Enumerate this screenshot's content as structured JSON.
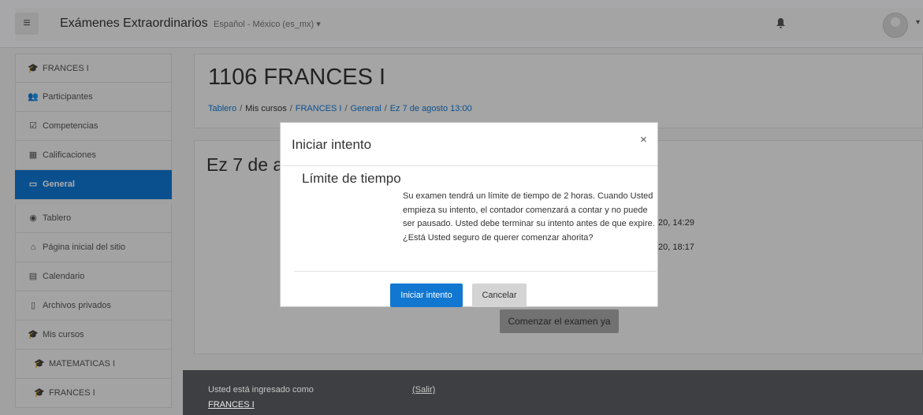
{
  "navbar": {
    "title": "Exámenes Extraordinarios",
    "language": "Español - México (es_mx) ▾",
    "hamburger_icon": "≡",
    "bell_icon": "🔔",
    "avatar_caret": "▾"
  },
  "sidebar": {
    "items": [
      {
        "icon": "graduation-cap-icon",
        "glyph": "🎓",
        "label": "FRANCES I"
      },
      {
        "icon": "users-icon",
        "glyph": "👥",
        "label": "Participantes"
      },
      {
        "icon": "check-square-icon",
        "glyph": "☑",
        "label": "Competencias"
      },
      {
        "icon": "table-icon",
        "glyph": "▦",
        "label": "Calificaciones"
      },
      {
        "icon": "folder-icon",
        "glyph": "▭",
        "label": "General",
        "active": true
      }
    ],
    "items2": [
      {
        "icon": "dashboard-icon",
        "glyph": "◉",
        "label": "Tablero"
      },
      {
        "icon": "home-icon",
        "glyph": "⌂",
        "label": "Página inicial del sitio"
      },
      {
        "icon": "calendar-icon",
        "glyph": "▤",
        "label": "Calendario"
      },
      {
        "icon": "file-icon",
        "glyph": "▯",
        "label": "Archivos privados"
      },
      {
        "icon": "graduation-cap-icon",
        "glyph": "🎓",
        "label": "Mis cursos"
      },
      {
        "icon": "graduation-cap-icon",
        "glyph": "🎓",
        "label": "MATEMATICAS I"
      },
      {
        "icon": "graduation-cap-icon",
        "glyph": "🎓",
        "label": "FRANCES I"
      }
    ]
  },
  "header": {
    "title": "1106 FRANCES I",
    "breadcrumb": [
      "Tablero",
      "Mis cursos",
      "FRANCES I",
      "General",
      "Ez 7 de agosto 13:00"
    ]
  },
  "content": {
    "section_title": "Ez 7 de a",
    "info_line_1": "20, 14:29",
    "info_line_2": "20, 18:17",
    "start_button": "Comenzar el examen ya"
  },
  "modal": {
    "title": "Iniciar intento",
    "close": "×",
    "subtitle": "Límite de tiempo",
    "text": "Su examen tendrá un límite de tiempo de 2 horas. Cuando Usted empieza su intento, el contador comenzará a contar y no puede ser pausado. Usted debe terminar su intento antes de que expire. ¿Está Usted seguro de querer comenzar ahorita?",
    "primary_button": "Iniciar intento",
    "secondary_button": "Cancelar"
  },
  "footer": {
    "logged_in_text": "Usted está ingresado como",
    "user": "FRANCES I",
    "logout": "(Salir)"
  },
  "colors": {
    "accent": "#1177d1",
    "footer_bg": "#3e3f43"
  }
}
